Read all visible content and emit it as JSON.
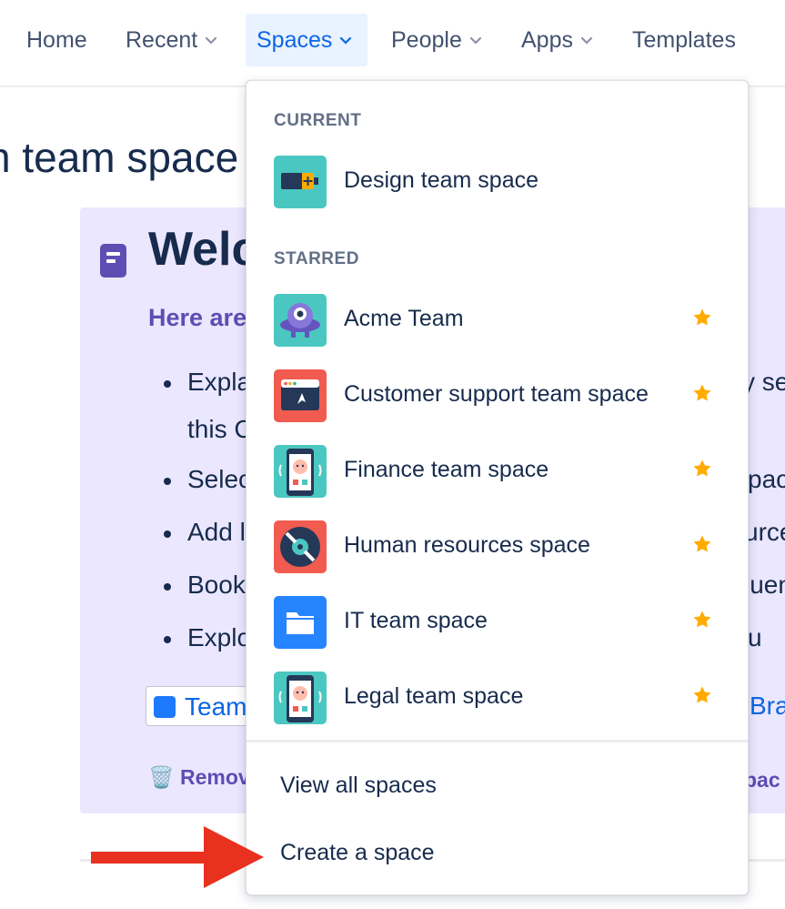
{
  "nav": {
    "items": [
      {
        "label": "Home",
        "has_chevron": false
      },
      {
        "label": "Recent",
        "has_chevron": true
      },
      {
        "label": "Spaces",
        "has_chevron": true,
        "active": true
      },
      {
        "label": "People",
        "has_chevron": true
      },
      {
        "label": "Apps",
        "has_chevron": true
      },
      {
        "label": "Templates",
        "has_chevron": false
      }
    ]
  },
  "page": {
    "title_fragment": "n team space",
    "welcome_fragment": "Welc",
    "here_fragment": "Here are",
    "bullets": [
      "Expla",
      "Selec",
      "Add l",
      "Book",
      "Explo"
    ],
    "bullet_second_line": "this C",
    "right_fragments": [
      "y se",
      "pac",
      "urce",
      "luen",
      "u"
    ],
    "team_chip_label": "Team",
    "bra_fragment": "Bra",
    "remove_fragment": "Remov",
    "spac_fragment": "pac"
  },
  "dropdown": {
    "current_heading": "CURRENT",
    "current_space": {
      "name": "Design team space",
      "icon": "battery-icon"
    },
    "starred_heading": "STARRED",
    "starred_spaces": [
      {
        "name": "Acme Team",
        "icon": "robot-ufo-icon",
        "starred": true
      },
      {
        "name": "Customer support team space",
        "icon": "browser-window-icon",
        "starred": true
      },
      {
        "name": "Finance team space",
        "icon": "phone-avatar-icon",
        "starred": true
      },
      {
        "name": "Human resources space",
        "icon": "vinyl-record-icon",
        "starred": true
      },
      {
        "name": "IT team space",
        "icon": "folder-icon",
        "starred": true
      },
      {
        "name": "Legal team space",
        "icon": "phone-avatar-icon",
        "starred": true
      }
    ],
    "view_all_label": "View all spaces",
    "create_label": "Create a space"
  },
  "colors": {
    "accent_blue": "#0c66e4",
    "star_yellow": "#ffab00",
    "panel_purple": "#ebe7fe",
    "annotation_red": "#e8311f"
  }
}
